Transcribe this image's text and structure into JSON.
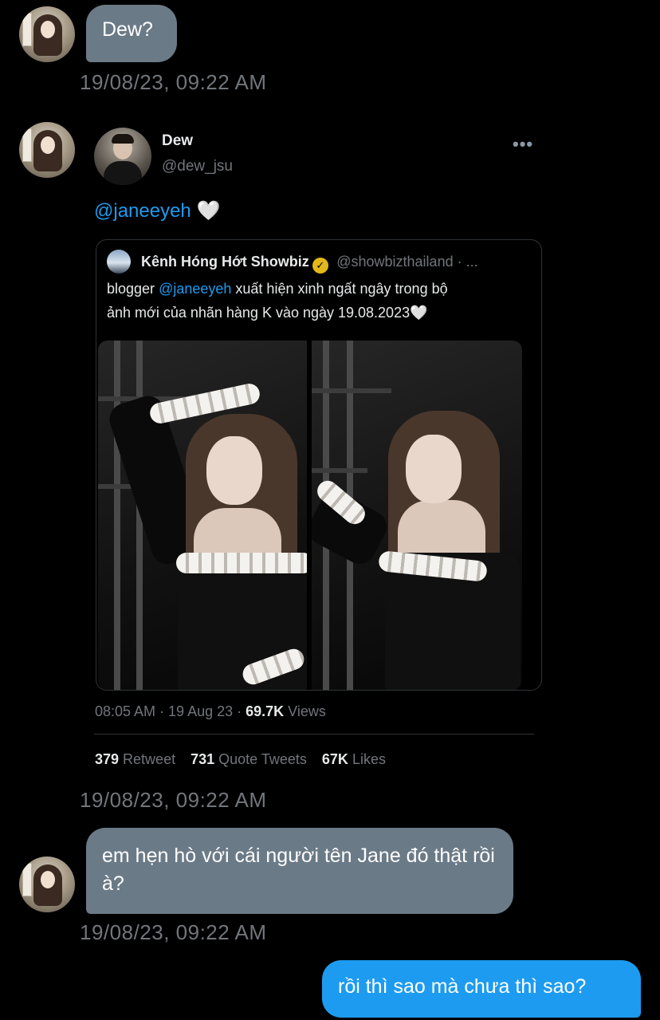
{
  "messages": [
    {
      "type": "incoming",
      "text": "Dew?",
      "timestamp": "19/08/23, 09:22 AM"
    },
    {
      "type": "incoming_tweet_share",
      "timestamp": "19/08/23, 09:22 AM"
    },
    {
      "type": "incoming",
      "text": "em hẹn hò với cái người tên Jane đó thật rồi à?",
      "timestamp": "19/08/23, 09:22 AM"
    },
    {
      "type": "outgoing",
      "text": "rồi thì sao mà chưa thì sao?"
    }
  ],
  "shared_tweet": {
    "author_name": "Dew",
    "author_handle": "@dew_jsu",
    "more_icon": "more-dots-icon",
    "mention": "@janeeyeh",
    "heart": "🤍",
    "quoted": {
      "author_name": "Kênh Hóng Hớt Showbiz",
      "verified_badge": "✓",
      "author_handle": "@showbizthailand · ...",
      "text_before": "blogger ",
      "text_link": "@janeeyeh",
      "text_line1_after": " xuất hiện xinh ngất ngây trong bộ",
      "text_line2": "ảnh mới của nhãn hàng K vào ngày 19.08.2023🤍"
    },
    "time": "08:05 AM · 19 Aug 23 · ",
    "views_count": "69.7K",
    "views_label": " Views",
    "retweets_count": "379",
    "retweets_label": " Retweet",
    "quotes_count": "731",
    "quotes_label": " Quote Tweets",
    "likes_count": "67K",
    "likes_label": " Likes"
  },
  "colors": {
    "background": "#000000",
    "incoming_bubble": "#6b7a87",
    "outgoing_bubble": "#1d9bf0",
    "link": "#1d9bf0",
    "muted_text": "#71767b"
  }
}
